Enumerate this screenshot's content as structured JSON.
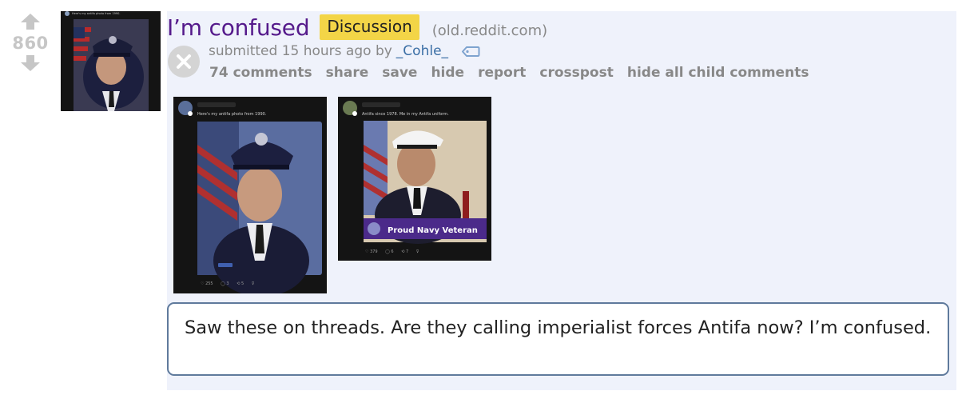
{
  "post": {
    "score": "860",
    "title": "I’m confused",
    "flair": "Discussion",
    "domain": "(old.reddit.com)",
    "submitted_prefix": "submitted 15 hours ago by",
    "author": "_Cohle_",
    "buttons": [
      "74 comments",
      "share",
      "save",
      "hide",
      "report",
      "crosspost",
      "hide all child comments"
    ],
    "selftext": "Saw these on threads. Are they calling imperialist forces Antifa now? I’m confused."
  },
  "thumbnail": {
    "caption": "Here's my antifa photo from 1990."
  },
  "screenshots": [
    {
      "caption": "Here's my antifa photo from 1990.",
      "stats": [
        "♡ 255",
        "◯ 3",
        "⟲ 5",
        "⊽"
      ]
    },
    {
      "caption": "Antifa since 1978. Me in my Antifa uniform.",
      "banner": "Proud Navy Veteran",
      "stats": [
        "♡ 379",
        "◯ 6",
        "⟲ 7",
        "⊽"
      ]
    }
  ],
  "icons": {
    "upvote": "upvote-arrow-icon",
    "downvote": "downvote-arrow-icon",
    "remove": "remove-x-icon",
    "tag": "tag-icon"
  },
  "colors": {
    "title": "#551a8b",
    "flair_bg": "#f3d547",
    "post_bg": "#eff2fb",
    "author": "#3a6ea5",
    "meta_gray": "#888888",
    "selftext_border": "#5f7a9c"
  }
}
